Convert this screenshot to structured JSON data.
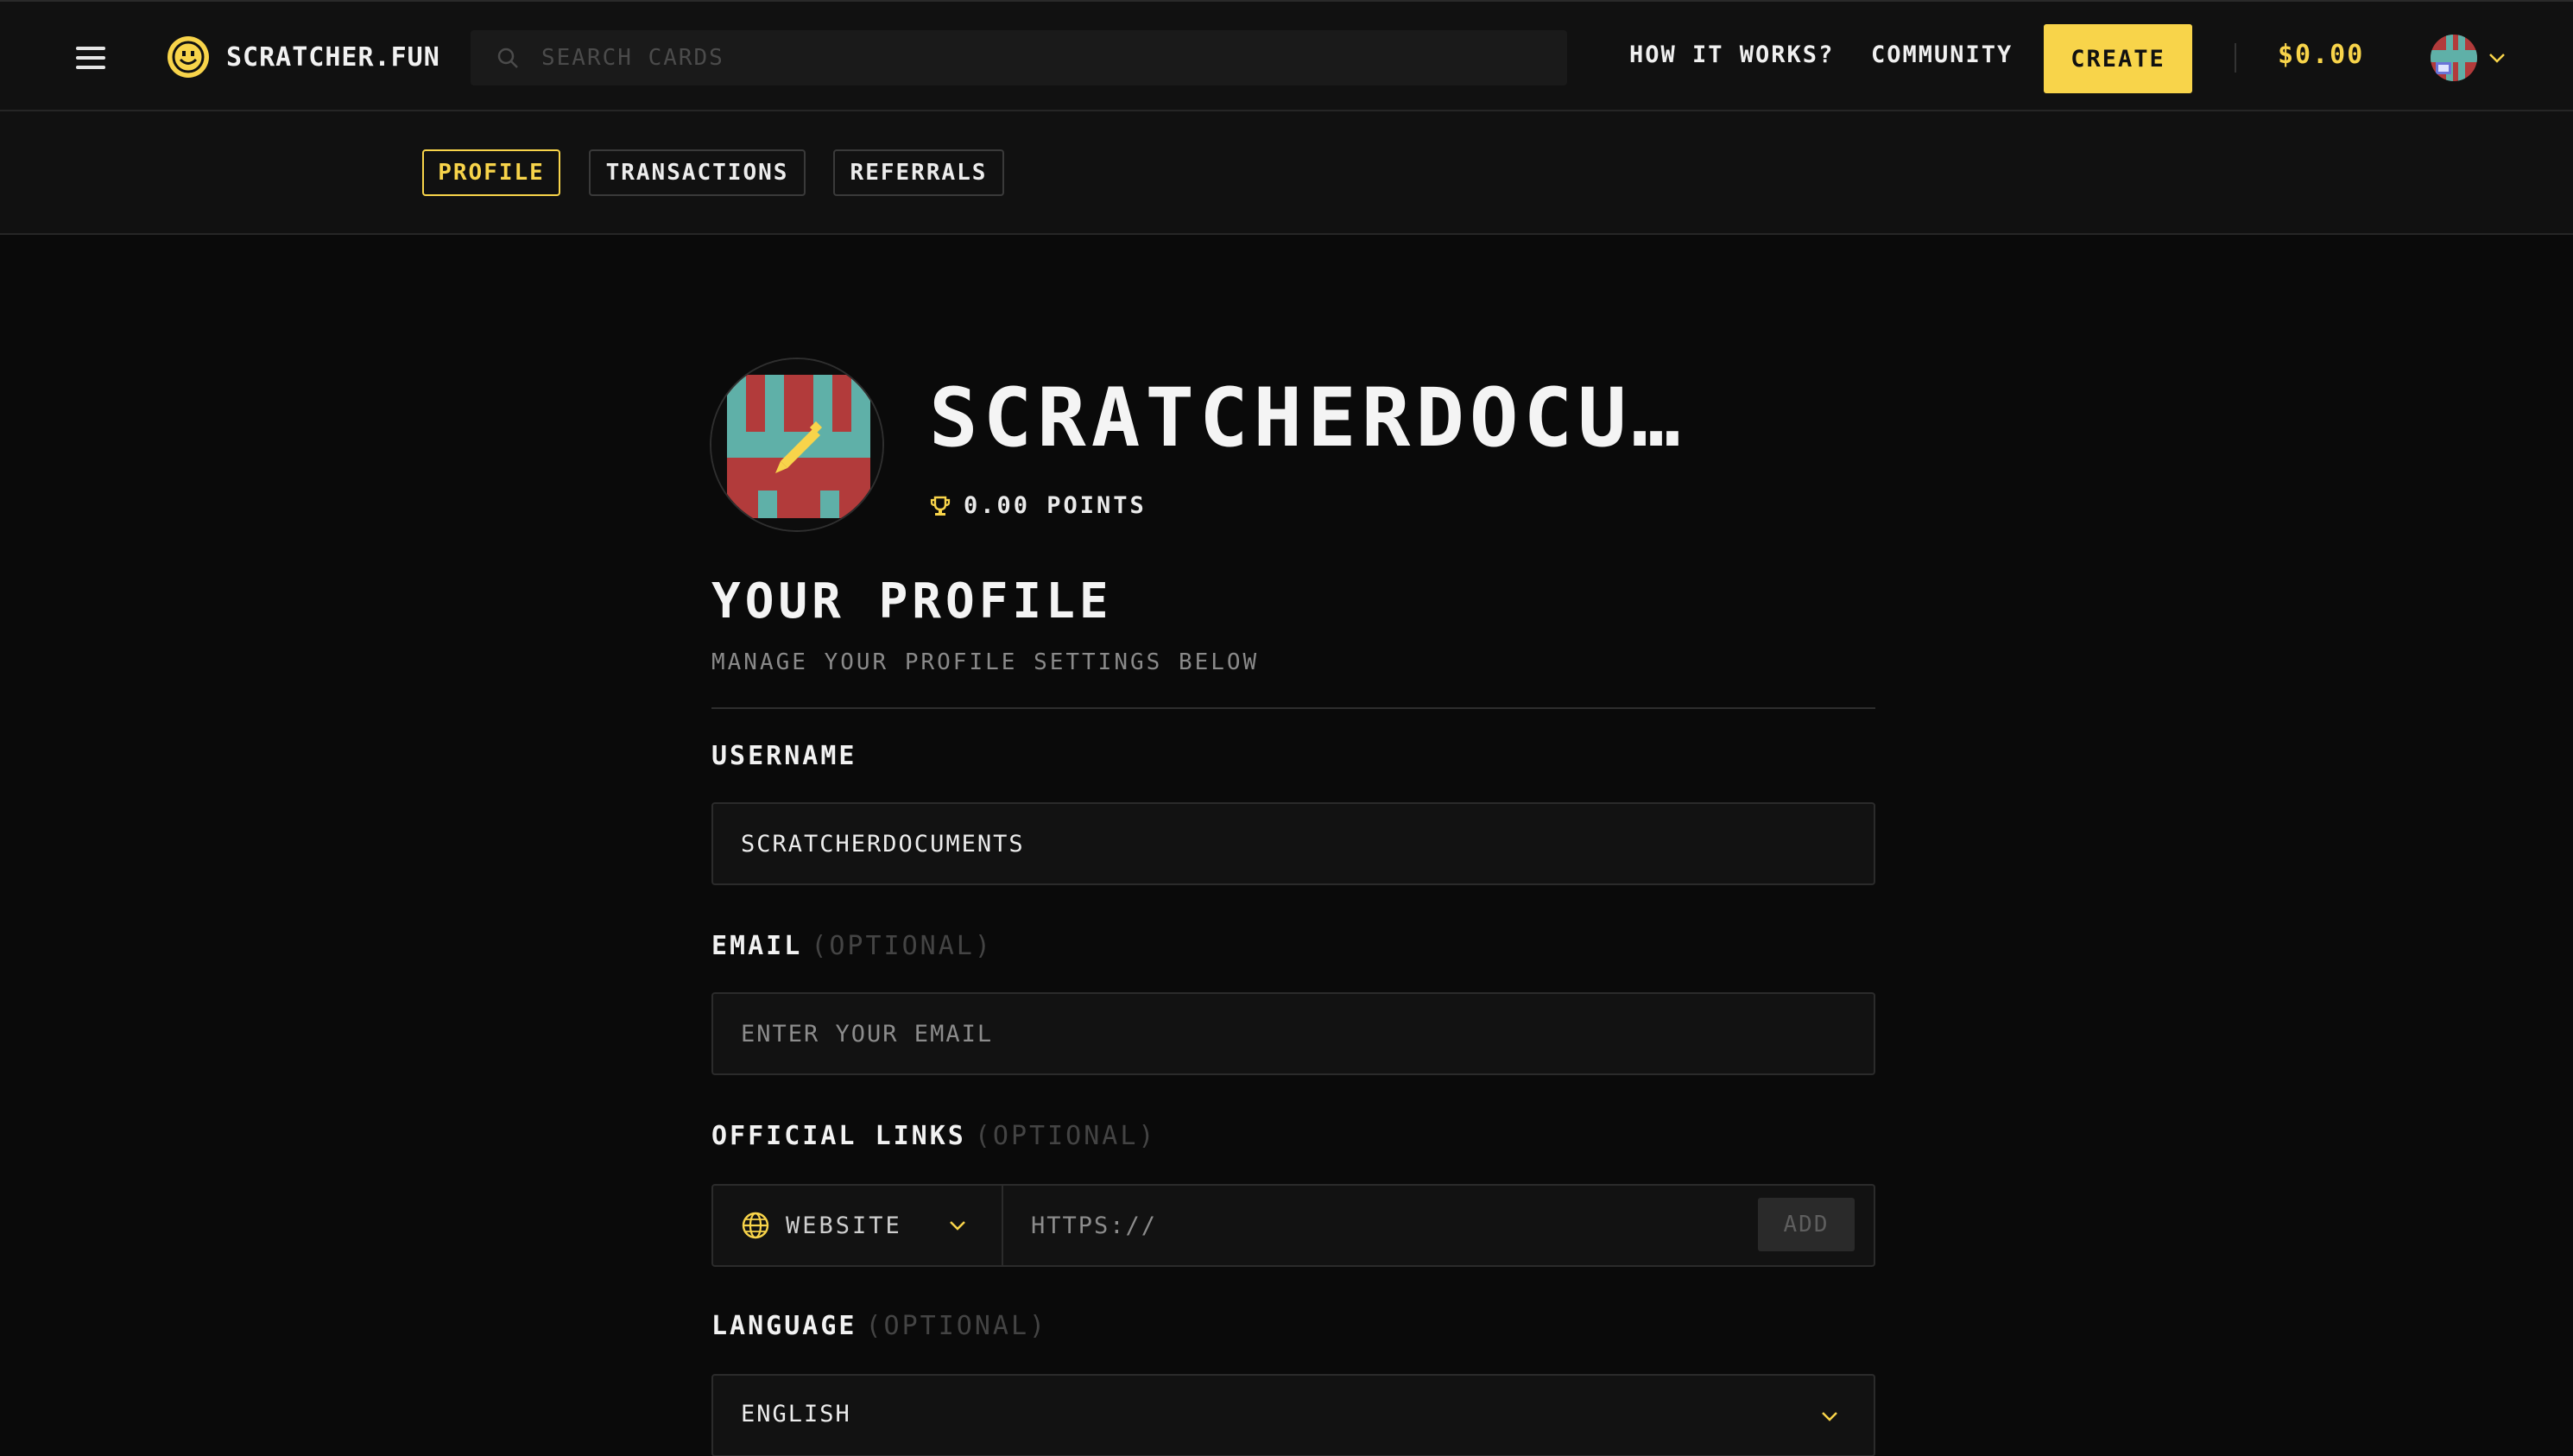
{
  "header": {
    "brand": "SCRATCHER.FUN",
    "search_placeholder": "SEARCH CARDS",
    "nav": {
      "how_it_works": "HOW IT WORKS?",
      "community": "COMMUNITY"
    },
    "create_label": "CREATE",
    "balance": "$0.00"
  },
  "tabs": [
    {
      "label": "PROFILE",
      "active": true
    },
    {
      "label": "TRANSACTIONS",
      "active": false
    },
    {
      "label": "REFERRALS",
      "active": false
    }
  ],
  "profile": {
    "display_name": "SCRATCHERDOCU…",
    "points": "0.00 POINTS"
  },
  "section": {
    "title": "YOUR PROFILE",
    "subtitle": "MANAGE YOUR PROFILE SETTINGS BELOW"
  },
  "form": {
    "username": {
      "label": "USERNAME",
      "value": "SCRATCHERDOCUMENTS"
    },
    "email": {
      "label": "EMAIL",
      "optional": "(OPTIONAL)",
      "placeholder": "ENTER YOUR EMAIL"
    },
    "links": {
      "label": "OFFICIAL LINKS",
      "optional": "(OPTIONAL)",
      "type": "WEBSITE",
      "placeholder": "HTTPS://",
      "add_label": "ADD"
    },
    "language": {
      "label": "LANGUAGE",
      "optional": "(OPTIONAL)",
      "value": "ENGLISH"
    }
  },
  "colors": {
    "accent": "#f8d44a",
    "background": "#0a0a0a",
    "panel": "#111111",
    "avatar_red": "#b23b3b",
    "avatar_teal": "#5fb0a8"
  },
  "icons": {
    "menu": "hamburger-icon",
    "logo": "smiley-icon",
    "search": "search-icon",
    "points": "trophy-icon",
    "link_type": "globe-icon",
    "dropdown": "chevron-down-icon"
  }
}
